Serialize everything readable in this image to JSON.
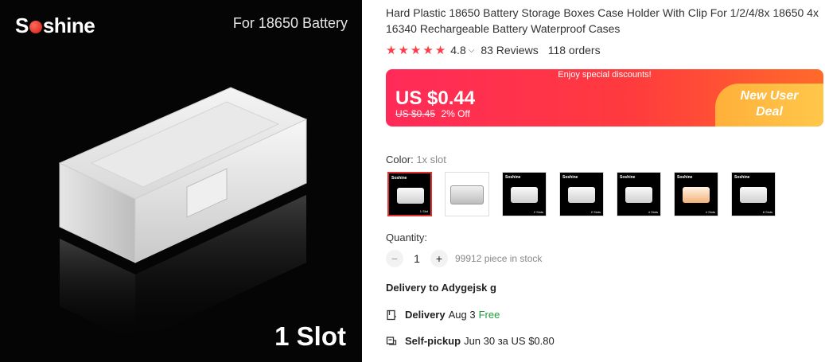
{
  "image": {
    "brand_prefix": "S",
    "brand_suffix": "shine",
    "tagline": "For 18650 Battery",
    "slot_label": "1 Slot"
  },
  "product": {
    "title": "Hard Plastic 18650 Battery Storage Boxes Case Holder With Clip For 1/2/4/8x 18650 4x 16340 Rechargeable Battery Waterproof Cases",
    "rating": "4.8",
    "stars": 5,
    "reviews": "83 Reviews",
    "orders": "118 orders"
  },
  "price_banner": {
    "promo_text": "Enjoy special discounts!",
    "price": "US $0.44",
    "old_price": "US $0.45",
    "discount": "2% Off",
    "new_user_deal": "New User Deal",
    "colors": {
      "start": "#ff2a59",
      "end": "#ff6a2a",
      "deal": "#ffc74a"
    }
  },
  "color": {
    "label": "Color:",
    "selected": "1x slot",
    "options": [
      {
        "name": "1x slot",
        "selected": true
      },
      {
        "name": "option-2",
        "selected": false
      },
      {
        "name": "option-3",
        "selected": false
      },
      {
        "name": "option-4",
        "selected": false
      },
      {
        "name": "option-5",
        "selected": false
      },
      {
        "name": "option-6",
        "selected": false
      },
      {
        "name": "option-7",
        "selected": false
      }
    ]
  },
  "quantity": {
    "label": "Quantity:",
    "value": "1",
    "minus": "−",
    "plus": "+",
    "stock": "99912 piece in stock"
  },
  "delivery": {
    "to": "Delivery to Adygejsk g",
    "delivery_label": "Delivery",
    "delivery_date": "Aug 3",
    "delivery_cost": "Free",
    "pickup_label": "Self-pickup",
    "pickup_info": "Jun 30 за US $0.80"
  }
}
